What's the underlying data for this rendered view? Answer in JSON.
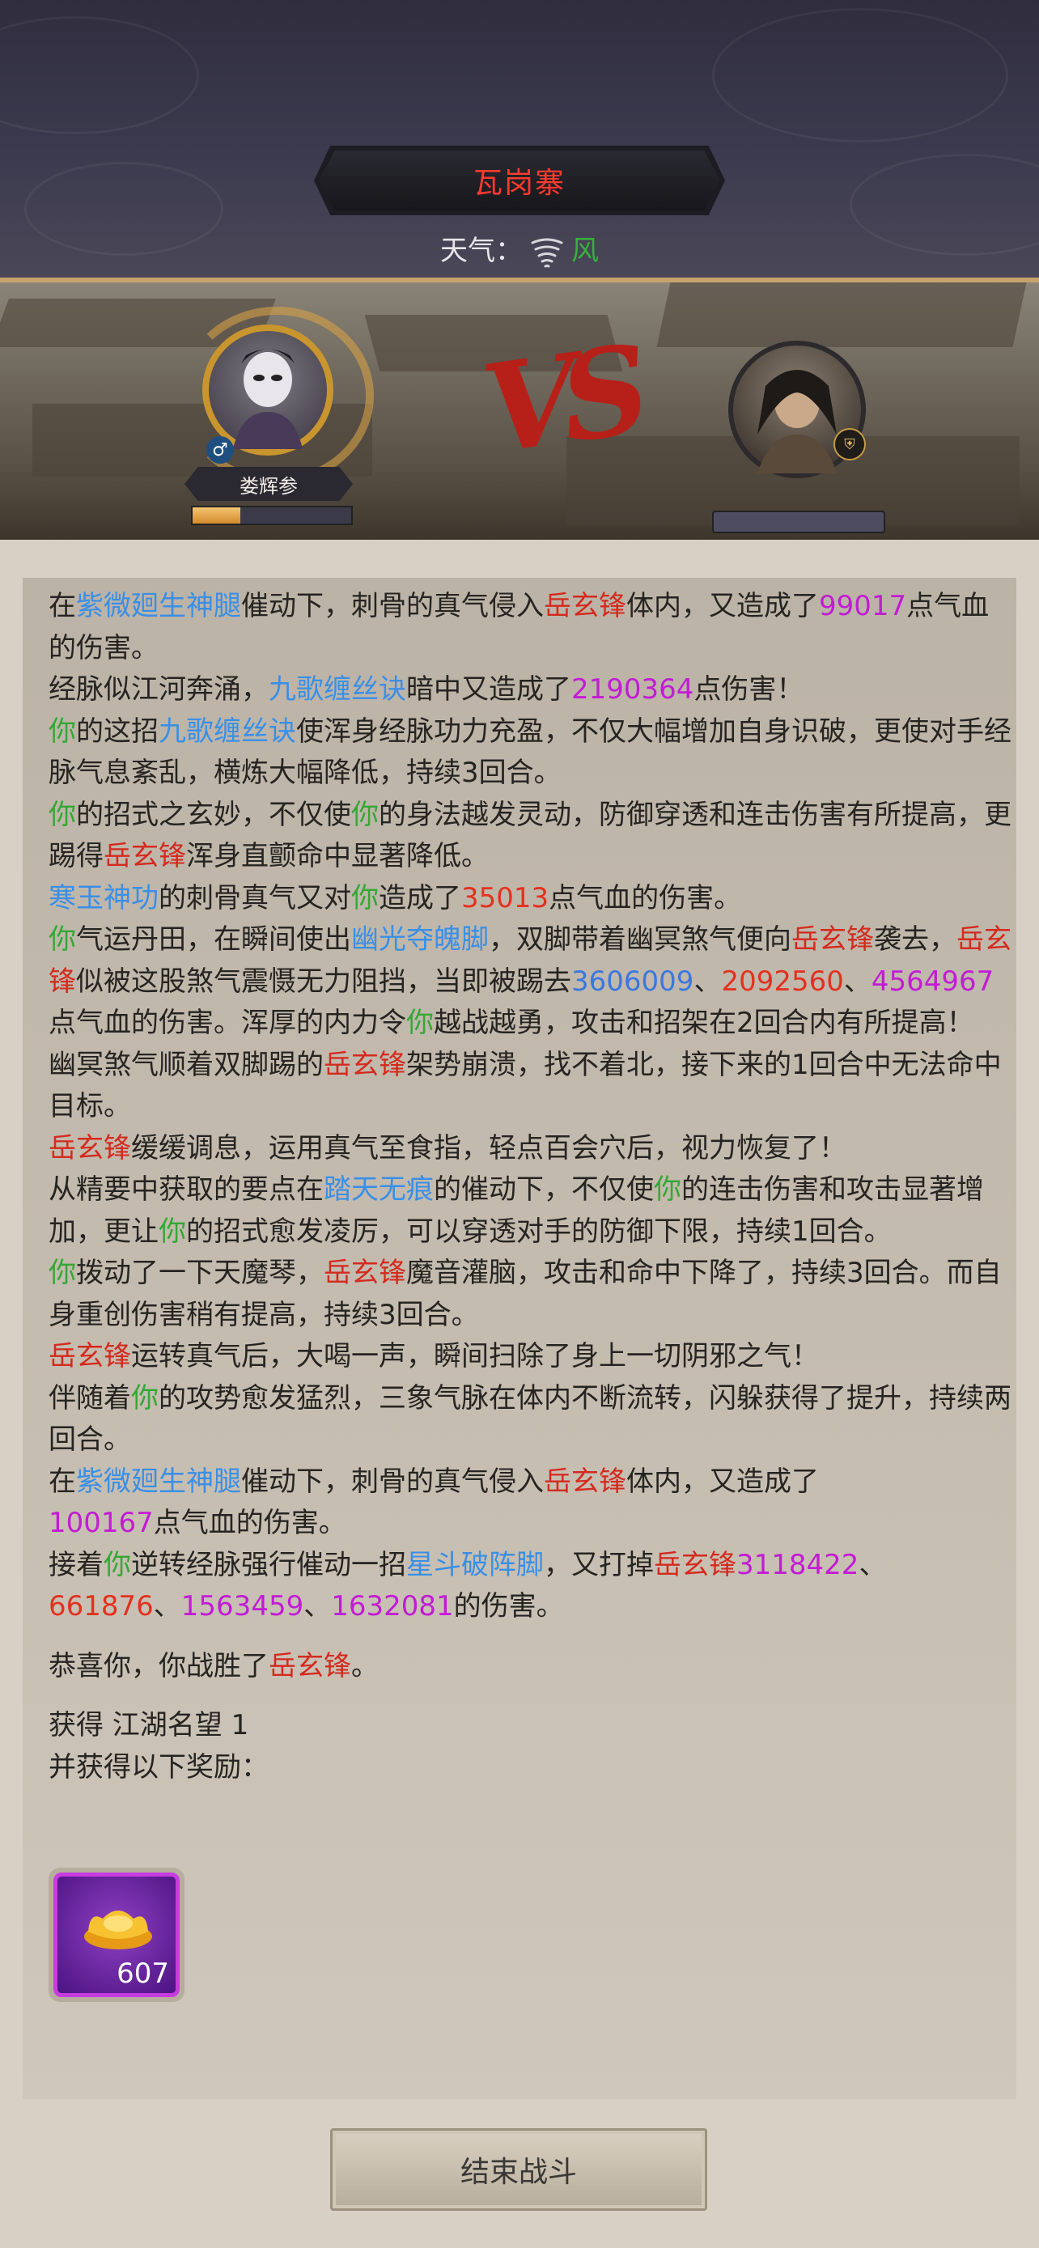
{
  "location": {
    "title": "瓦岗寨"
  },
  "weather": {
    "label": "天气：",
    "icon": "whirlwind-icon",
    "value": "风",
    "value_color": "#35b23a"
  },
  "battle": {
    "vs": "VS",
    "player": {
      "name": "娄辉参",
      "gender": "♂",
      "hp_fraction": 0.3
    },
    "enemy": {
      "badge_icon": "shield-icon"
    }
  },
  "log": {
    "lines": [
      [
        "在",
        {
          "t": "紫微廻生神腿",
          "c": "s"
        },
        "催动下，刺骨的真气侵入",
        {
          "t": "岳玄锋",
          "c": "e"
        },
        "体内，又造成了",
        {
          "t": "99017",
          "c": "n"
        },
        "点气血的伤害。"
      ],
      [
        "经脉似江河奔涌，",
        {
          "t": "九歌缠丝诀",
          "c": "s"
        },
        "暗中又造成了",
        {
          "t": "2190364",
          "c": "n"
        },
        "点伤害！"
      ],
      [
        {
          "t": "你",
          "c": "y"
        },
        "的这招",
        {
          "t": "九歌缠丝诀",
          "c": "s"
        },
        "使浑身经脉功力充盈，不仅大幅增加自身识破，更使对手经脉气息紊乱，横炼大幅降低，持续3回合。"
      ],
      [
        {
          "t": "你",
          "c": "y"
        },
        "的招式之玄妙，不仅使",
        {
          "t": "你",
          "c": "y"
        },
        "的身法越发灵动，防御穿透和连击伤害有所提高，更踢得",
        {
          "t": "岳玄锋",
          "c": "e"
        },
        "浑身直颤命中显著降低。"
      ],
      [
        {
          "t": "寒玉神功",
          "c": "s"
        },
        "的刺骨真气又对",
        {
          "t": "你",
          "c": "y"
        },
        "造成了",
        {
          "t": "35013",
          "c": "nr"
        },
        "点气血的伤害。"
      ],
      [
        {
          "t": "你",
          "c": "y"
        },
        "气运丹田，在瞬间使出",
        {
          "t": "幽光夺魄脚",
          "c": "s"
        },
        "，双脚带着幽冥煞气便向",
        {
          "t": "岳玄锋",
          "c": "e"
        },
        "袭去，",
        {
          "t": "岳玄锋",
          "c": "e"
        },
        "似被这股煞气震慑无力阻挡，当即被踢去",
        {
          "t": "3606009",
          "c": "nb"
        },
        "、",
        {
          "t": "2092560",
          "c": "nr"
        },
        "、",
        {
          "t": "4564967",
          "c": "n"
        },
        "点气血的伤害。浑厚的内力令",
        {
          "t": "你",
          "c": "y"
        },
        "越战越勇，攻击和招架在2回合内有所提高！"
      ],
      [
        "幽冥煞气顺着双脚踢的",
        {
          "t": "岳玄锋",
          "c": "e"
        },
        "架势崩溃，找不着北，接下来的1回合中无法命中目标。"
      ],
      [
        {
          "t": "岳玄锋",
          "c": "e"
        },
        "缓缓调息，运用真气至食指，轻点百会穴后，视力恢复了！"
      ],
      [
        "从精要中获取的要点在",
        {
          "t": "踏天无痕",
          "c": "s"
        },
        "的催动下，不仅使",
        {
          "t": "你",
          "c": "y"
        },
        "的连击伤害和攻击显著增加，更让",
        {
          "t": "你",
          "c": "y"
        },
        "的招式愈发凌厉，可以穿透对手的防御下限，持续1回合。"
      ],
      [
        {
          "t": "你",
          "c": "y"
        },
        "拨动了一下天魔琴，",
        {
          "t": "岳玄锋",
          "c": "e"
        },
        "魔音灌脑，攻击和命中下降了，持续3回合。而自身重创伤害稍有提高，持续3回合。"
      ],
      [
        {
          "t": "岳玄锋",
          "c": "e"
        },
        "运转真气后，大喝一声，瞬间扫除了身上一切阴邪之气！"
      ],
      [
        "伴随着",
        {
          "t": "你",
          "c": "y"
        },
        "的攻势愈发猛烈，三象气脉在体内不断流转，闪躲获得了提升，持续两回合。"
      ],
      [
        "在",
        {
          "t": "紫微廻生神腿",
          "c": "s"
        },
        "催动下，刺骨的真气侵入",
        {
          "t": "岳玄锋",
          "c": "e"
        },
        "体内，又造成了",
        {
          "br": true
        },
        {
          "t": "100167",
          "c": "n"
        },
        "点气血的伤害。"
      ],
      [
        "接着",
        {
          "t": "你",
          "c": "y"
        },
        "逆转经脉强行催动一招",
        {
          "t": "星斗破阵脚",
          "c": "s"
        },
        "，又打掉",
        {
          "t": "岳玄锋",
          "c": "e"
        },
        {
          "t": "3118422",
          "c": "n"
        },
        "、",
        {
          "t": "661876",
          "c": "nr"
        },
        "、",
        {
          "t": "1563459",
          "c": "n"
        },
        "、",
        {
          "t": "1632081",
          "c": "n"
        },
        "的伤害。"
      ]
    ],
    "victory": [
      "恭喜你，你战胜了",
      {
        "t": "岳玄锋",
        "c": "e"
      },
      "。"
    ],
    "reward_line_1": "获得 江湖名望 1",
    "reward_line_2": "并获得以下奖励："
  },
  "reward": {
    "icon": "gold-ingot-icon",
    "count": "607",
    "frame_color": "#c73ce0"
  },
  "footer": {
    "end_button_label": "结束战斗"
  }
}
